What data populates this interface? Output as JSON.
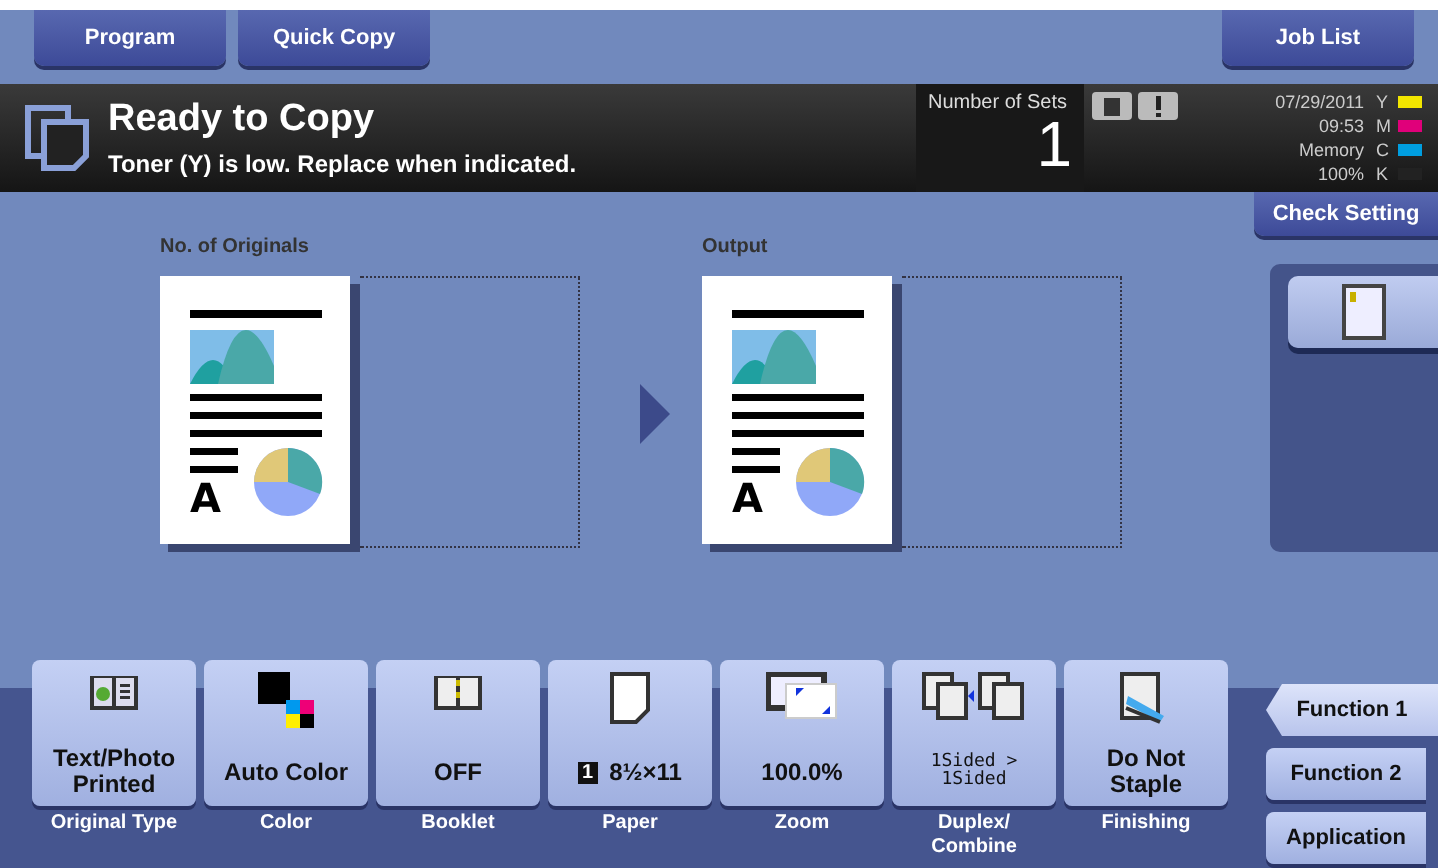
{
  "top_tabs": [
    {
      "label": "Program",
      "selected": false
    },
    {
      "label": "Quick Copy",
      "selected": false
    }
  ],
  "job_list_button": {
    "label": "Job List"
  },
  "status_bar": {
    "title": "Ready to Copy",
    "message": "Toner (Y) is low. Replace when indicated.",
    "sets_label": "Number of Sets",
    "sets_value": "1",
    "date": "07/29/2011",
    "time": "09:53",
    "memory_label": "Memory",
    "memory_value": "100%",
    "toner": [
      {
        "label": "Y",
        "color": "#f2e600"
      },
      {
        "label": "M",
        "color": "#e0007a"
      },
      {
        "label": "C",
        "color": "#009ee0"
      },
      {
        "label": "K",
        "color": "#222222"
      }
    ]
  },
  "check_setting_button": {
    "label": "Check Setting"
  },
  "preview": {
    "originals_label": "No. of Originals",
    "output_label": "Output",
    "originals_page_letter": "A",
    "output_page_letter": "A"
  },
  "functions": [
    {
      "kind": "original",
      "value": "Text/Photo\nPrinted",
      "label": "Original Type"
    },
    {
      "kind": "color",
      "value": "Auto Color",
      "label": "Color"
    },
    {
      "kind": "booklet",
      "value": "OFF",
      "label": "Booklet"
    },
    {
      "kind": "paper",
      "badge": "1",
      "value": "8½×11",
      "label": "Paper"
    },
    {
      "kind": "zoom",
      "value": "100.0%",
      "label": "Zoom"
    },
    {
      "kind": "duplex",
      "value": "1Sided >\n1Sided",
      "label": "Duplex/\nCombine"
    },
    {
      "kind": "finishing",
      "value": "Do Not\nStaple",
      "label": "Finishing"
    }
  ],
  "side_tabs": [
    {
      "label": "Function 1",
      "selected": true
    },
    {
      "label": "Function 2",
      "selected": false
    },
    {
      "label": "Application",
      "selected": false
    }
  ]
}
